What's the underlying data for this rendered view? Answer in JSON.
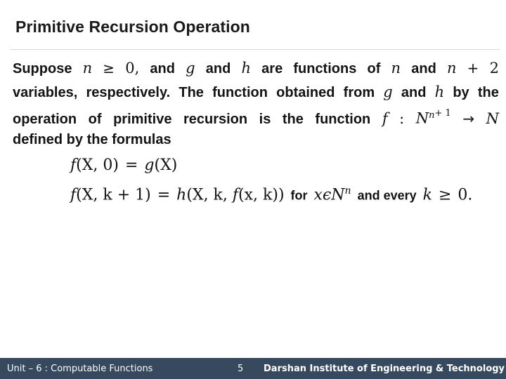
{
  "slide": {
    "title": "Primitive Recursion Operation",
    "accent_color": "#36495e",
    "background_color": "#ffffff",
    "text_color": "#141414"
  },
  "body": {
    "line1": {
      "w1": "Suppose",
      "v1": "n",
      "op1": "≥",
      "n0": "0,",
      "w2": "and",
      "v2": "g",
      "w3": "and",
      "v3": "h",
      "w4": "are",
      "w5": "functions",
      "w6": "of",
      "v4": "n",
      "w7": "and",
      "v5": "n",
      "op2": "+",
      "n2": "2"
    },
    "line2": {
      "w1": "variables,",
      "w2": "respectively.",
      "w3": "The",
      "w4": "function",
      "w5": "obtained",
      "w6": "from",
      "v1": "g",
      "w7": "and",
      "v2": "h",
      "w8": "by",
      "w9": "the"
    },
    "line3": {
      "w1": "operation",
      "w2": "of",
      "w3": "primitive",
      "w4": "recursion",
      "w5": "is",
      "w6": "the",
      "w7": "function",
      "v1": "f",
      "colon": ":",
      "v2": "N",
      "sup_n": "n",
      "sup_plus1": "+ 1",
      "arrow": "→",
      "v3": "N"
    },
    "line4": {
      "w1": "defined by the formulas"
    }
  },
  "formulas": {
    "formula1": {
      "lhs_f": "f",
      "lhs_args": "(X, 0)",
      "eq": "=",
      "rhs_g": "g",
      "rhs_args": "(X)"
    },
    "formula2": {
      "lhs_f": "f",
      "lhs_args": "(X, k + 1)",
      "eq": "=",
      "rhs_h": "h",
      "rhs_args_a": "(X, k, ",
      "rhs_inner_f": "f",
      "rhs_args_b": "(x, k))",
      "tail_for": "for",
      "tail_x": "x",
      "tail_epsilon": "ϵ",
      "tail_N": "N",
      "tail_sup_n": "n",
      "tail_and_every": "and every",
      "tail_k": "k",
      "tail_ge": "≥",
      "tail_zero": "0."
    }
  },
  "footer": {
    "unit_label": "Unit – 6 : Computable Functions",
    "page_number": "5",
    "institute": "Darshan Institute of Engineering & Technology"
  }
}
